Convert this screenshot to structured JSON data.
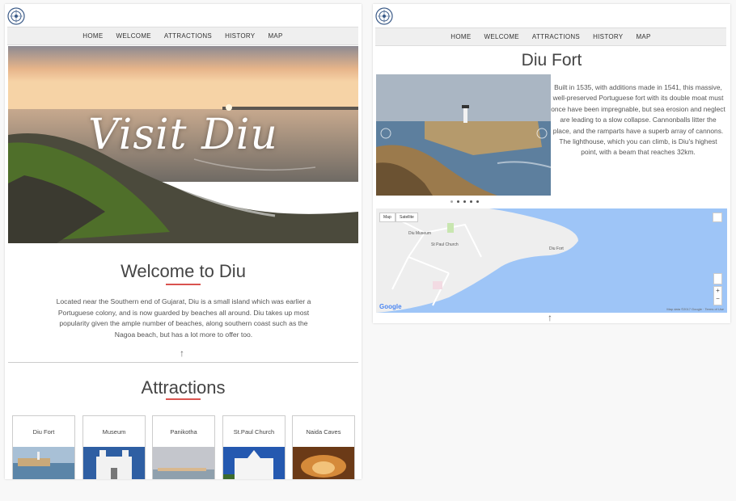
{
  "nav": {
    "items": [
      "HOME",
      "WELCOME",
      "ATTRACTIONS",
      "HISTORY",
      "MAP"
    ]
  },
  "hero": {
    "title": "Visit Diu"
  },
  "welcome": {
    "heading": "Welcome to Diu",
    "text": "Located near the Southern end of Gujarat, Diu is a small island which was earlier a Portuguese colony, and is now guarded by beaches all around. Diu takes up most popularity given the ample number of beaches, along southern coast such as the Nagoa beach, but has a lot more to offer too."
  },
  "attractions": {
    "heading": "Attractions",
    "cards": [
      "Diu Fort",
      "Museum",
      "Panikotha",
      "St.Paul Church",
      "Naida Caves"
    ]
  },
  "fort": {
    "heading": "Diu Fort",
    "text": "Built in 1535, with additions made in 1541, this massive, well-preserved Portuguese fort with its double moat must once have been impregnable, but sea erosion and neglect are leading to a slow collapse. Cannonballs litter the place, and the ramparts have a superb array of cannons. The lighthouse, which you can climb, is Diu's highest point, with a beam that reaches 32km."
  },
  "map": {
    "map_btn": "Map",
    "satellite_btn": "Satellite",
    "labels": {
      "museum": "Diu Museum",
      "church": "St Paul Church",
      "fort": "Diu Fort"
    },
    "attribution": "Map data ©2017 Google · Terms of Use",
    "logo": "Google"
  },
  "arrow": "↑",
  "colors": {
    "accent": "#d9534f",
    "nav_bg": "#efefef",
    "sea": "#9ec5f7"
  }
}
